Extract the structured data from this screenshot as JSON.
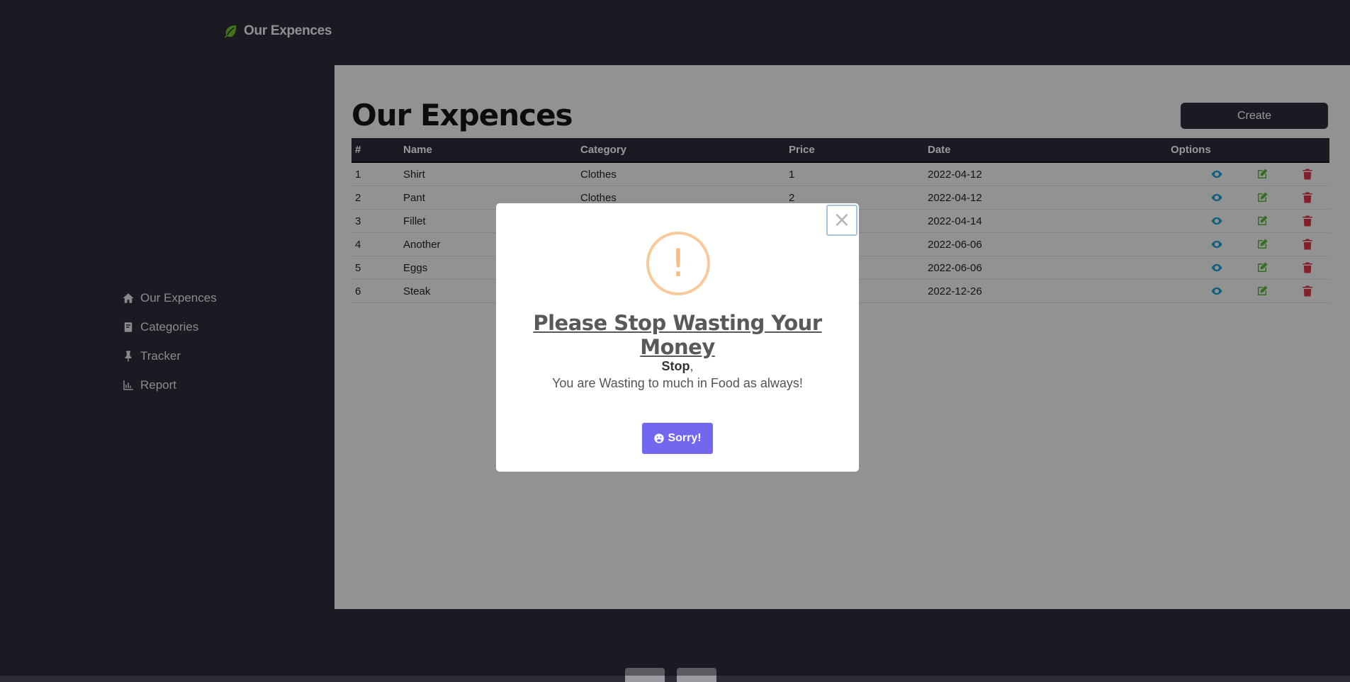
{
  "brand": {
    "name": "Our Expences",
    "icon": "leaf-icon",
    "accent": "#6fbf2a"
  },
  "sidebar": {
    "items": [
      {
        "label": "Our Expences",
        "icon": "home-icon"
      },
      {
        "label": "Categories",
        "icon": "book-icon"
      },
      {
        "label": "Tracker",
        "icon": "thumbtack-icon"
      },
      {
        "label": "Report",
        "icon": "chart-icon"
      }
    ]
  },
  "main": {
    "title": "Our Expences",
    "create_label": "Create",
    "table": {
      "headers": [
        "#",
        "Name",
        "Category",
        "Price",
        "Date",
        "Options"
      ],
      "rows": [
        [
          "1",
          "Shirt",
          "Clothes",
          "1",
          "2022-04-12"
        ],
        [
          "2",
          "Pant",
          "Clothes",
          "2",
          "2022-04-12"
        ],
        [
          "3",
          "Fillet",
          "",
          "",
          "2022-04-14"
        ],
        [
          "4",
          "Another",
          "",
          "",
          "2022-06-06"
        ],
        [
          "5",
          "Eggs",
          "",
          "",
          "2022-06-06"
        ],
        [
          "6",
          "Steak",
          "",
          "",
          "2022-12-26"
        ]
      ],
      "option_icons": [
        "eye-icon",
        "edit-icon",
        "trash-icon"
      ],
      "colors": {
        "view": "#1d9fd2",
        "edit": "#5ab43c",
        "delete": "#dc3545"
      }
    }
  },
  "modal": {
    "icon": "warning-icon",
    "icon_glyph": "!",
    "close_glyph": "×",
    "title": "Please Stop Wasting Your Money",
    "text_strong": "Stop",
    "text_comma": ",",
    "text_line": "You are Wasting to much in Food as always!",
    "button_label": "Sorry!",
    "button_icon": "sad-face-icon",
    "button_color": "#7367f0"
  }
}
